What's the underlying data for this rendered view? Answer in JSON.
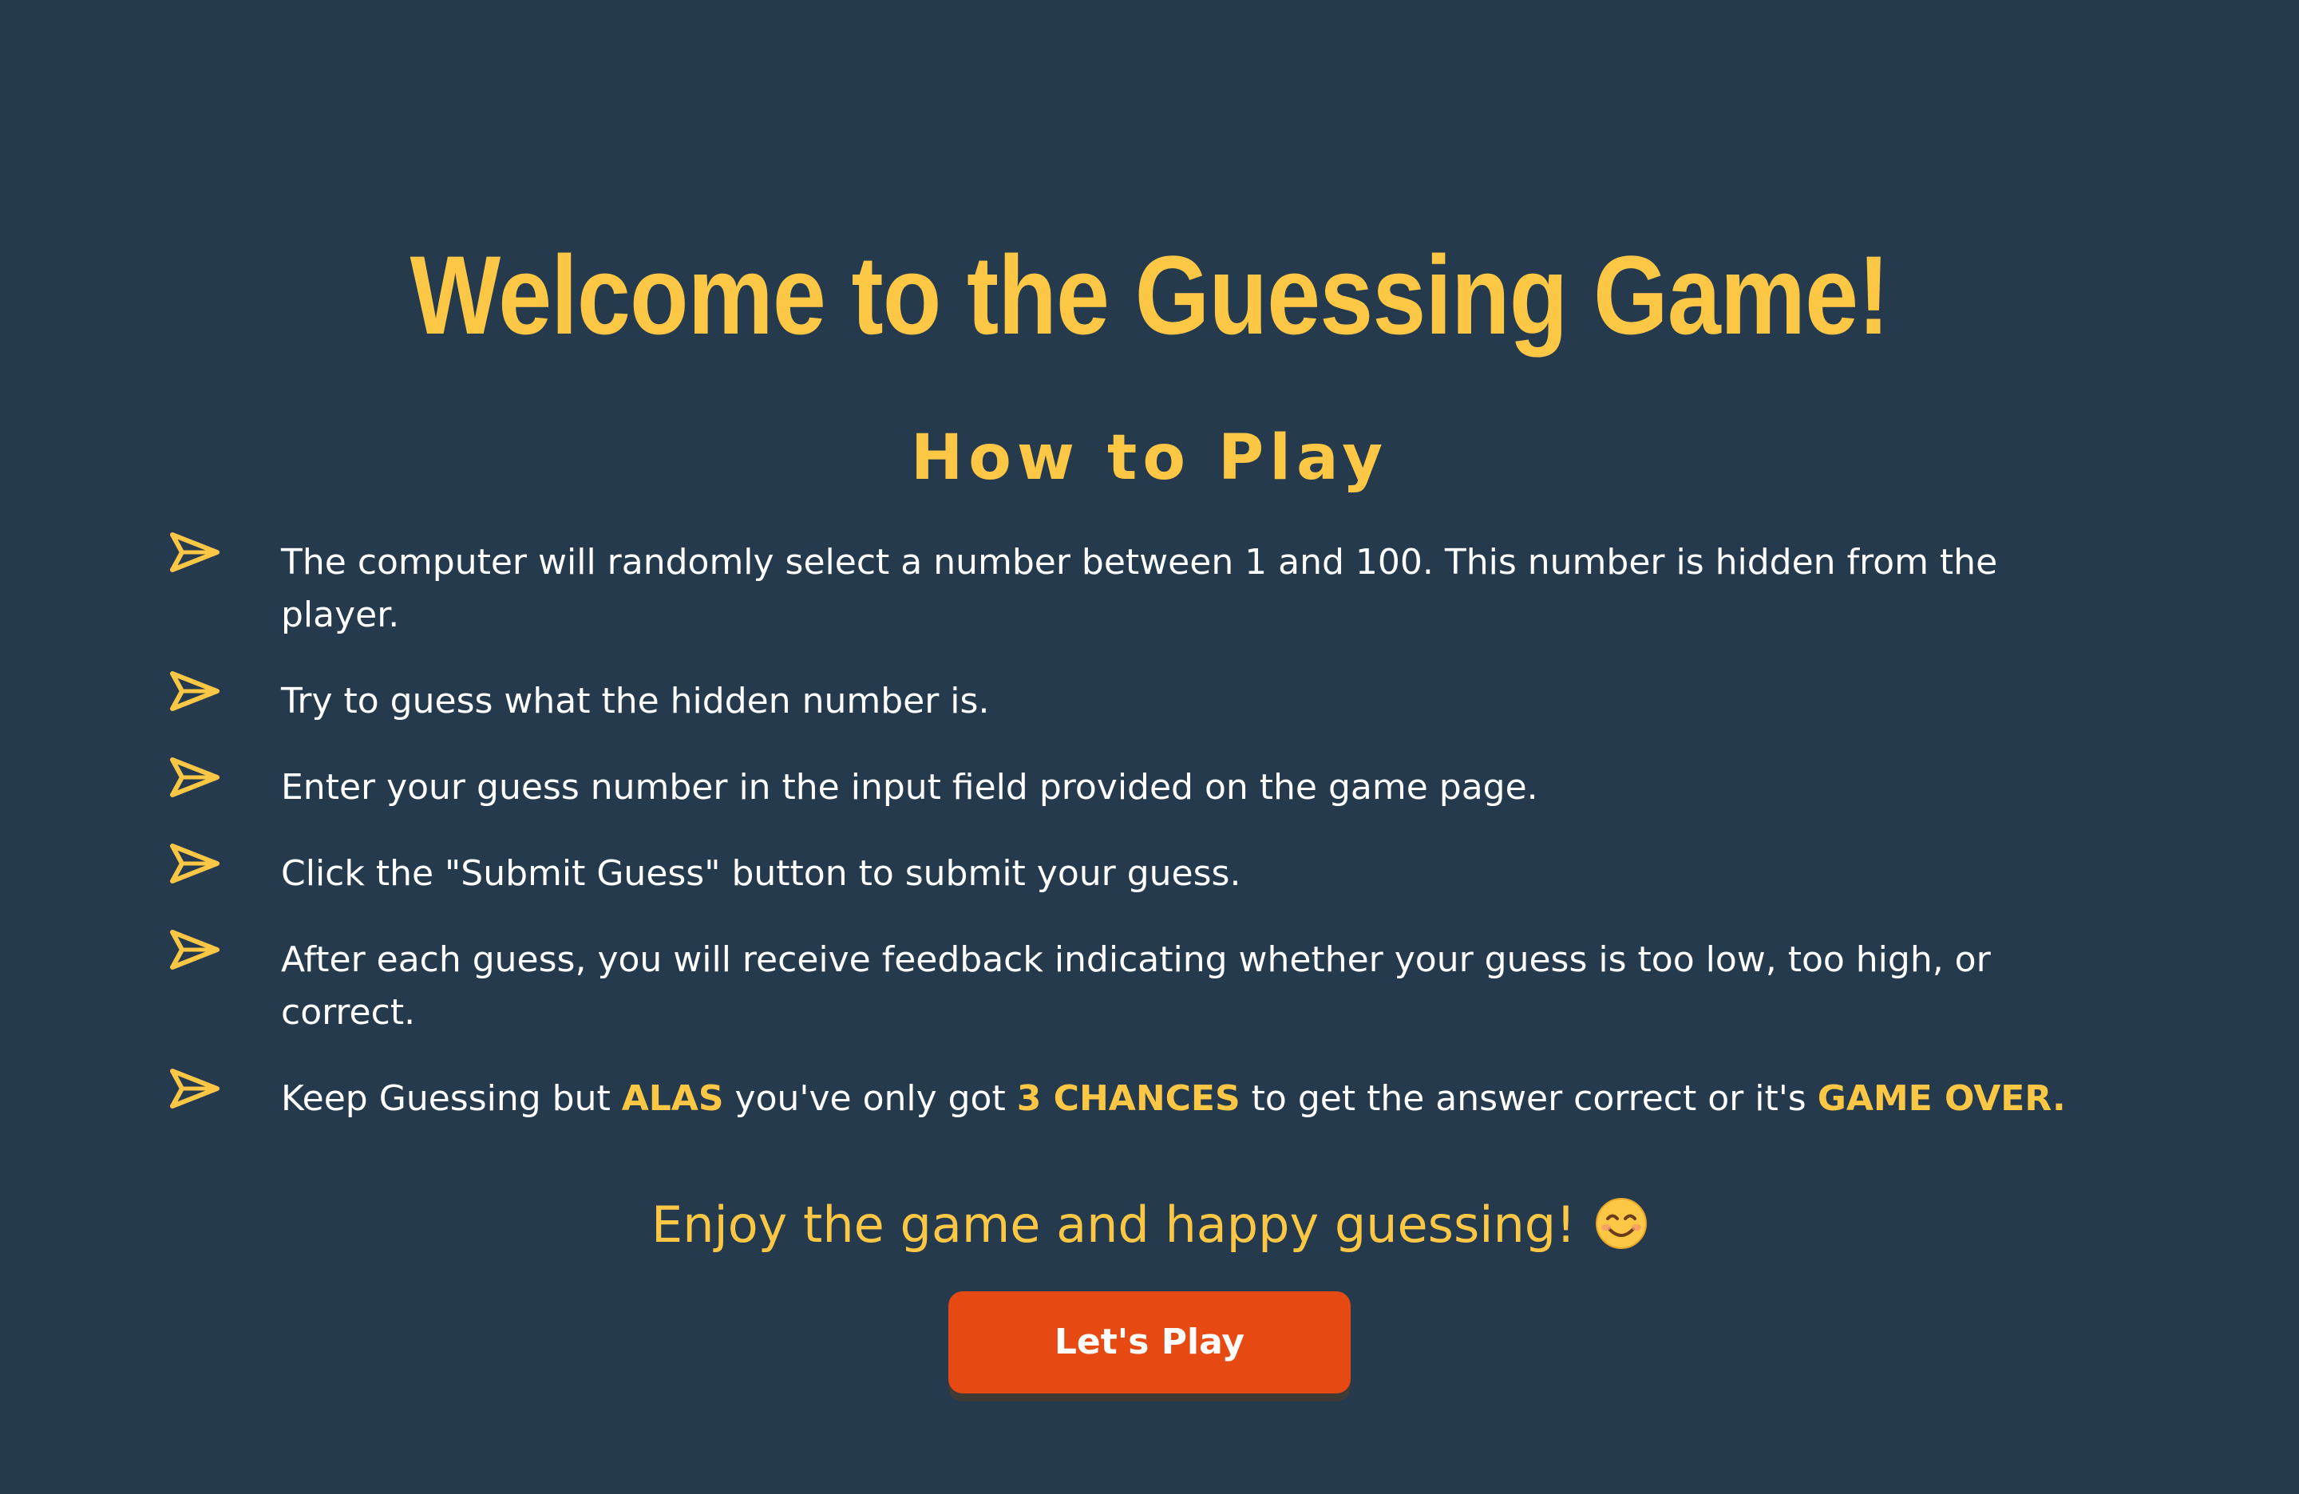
{
  "header": {
    "title": "Welcome to the Guessing Game!",
    "subtitle": "How to Play"
  },
  "rules": [
    {
      "icon": "arrow-bullet-icon",
      "text": "The computer will randomly select a number between 1 and 100. This number is hidden from the player."
    },
    {
      "icon": "arrow-bullet-icon",
      "text": "Try to guess what the hidden number is."
    },
    {
      "icon": "arrow-bullet-icon",
      "text": "Enter your guess number in the input field provided on the game page."
    },
    {
      "icon": "arrow-bullet-icon",
      "text": "Click the \"Submit Guess\" button to submit your guess."
    },
    {
      "icon": "arrow-bullet-icon",
      "text": "After each guess, you will receive feedback indicating whether your guess is too low, too high, or correct."
    },
    {
      "icon": "arrow-bullet-icon",
      "parts": {
        "t1": "Keep Guessing but ",
        "h1": "ALAS",
        "t2": " you've only got ",
        "h2": "3 CHANCES",
        "t3": " to get the answer correct or it's ",
        "h3": "GAME OVER."
      }
    }
  ],
  "footer": {
    "enjoy_text": "Enjoy the game and happy guessing!",
    "emoji_icon": "smiling-face-icon",
    "play_button_label": "Let's Play"
  },
  "colors": {
    "background": "#253b4d",
    "accent": "#fcc744",
    "button": "#e64a12",
    "text": "#ffffff"
  }
}
